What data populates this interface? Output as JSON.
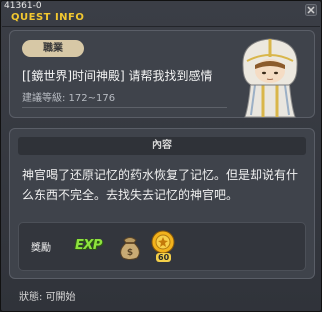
{
  "window": {
    "quest_id": "41361-0",
    "title": "QUEST INFO"
  },
  "quest": {
    "job_label": "職業",
    "name": "[[鏡世界]时间神殿] 请帮我找到感情",
    "level_text": "建議等級: 172~176"
  },
  "content": {
    "header": "內容",
    "text": "神官喝了还原记忆的药水恢复了记忆。但是却说有什么东西不完全。去找失去记忆的神官吧。"
  },
  "reward": {
    "label": "獎勵",
    "exp_label": "EXP",
    "coin_count": "60"
  },
  "status": {
    "text": "狀態: 可開始"
  },
  "icons": {
    "close": "close-icon",
    "exp": "exp-icon",
    "bag": "money-bag-icon",
    "coin": "coin-icon",
    "npc": "npc-priest-portrait"
  },
  "colors": {
    "title": "#f2c830",
    "exp": "#8ee33f",
    "badge": "#d7c8a6"
  }
}
